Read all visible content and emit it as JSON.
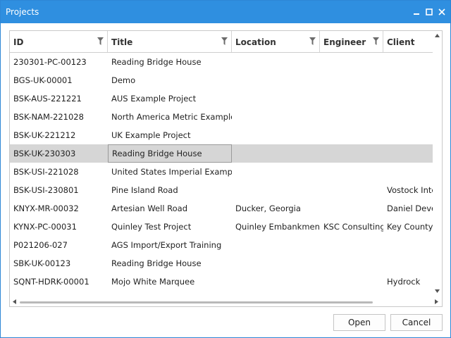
{
  "window": {
    "title": "Projects"
  },
  "columns": [
    {
      "label": "ID"
    },
    {
      "label": "Title"
    },
    {
      "label": "Location"
    },
    {
      "label": "Engineer"
    },
    {
      "label": "Client"
    }
  ],
  "rows": [
    {
      "id": "230301-PC-00123",
      "title": "Reading Bridge House",
      "location": "",
      "engineer": "",
      "client": ""
    },
    {
      "id": "BGS-UK-00001",
      "title": "Demo",
      "location": "",
      "engineer": "",
      "client": ""
    },
    {
      "id": "BSK-AUS-221221",
      "title": "AUS Example Project",
      "location": "",
      "engineer": "",
      "client": ""
    },
    {
      "id": "BSK-NAM-221028",
      "title": "North America Metric Example P",
      "location": "",
      "engineer": "",
      "client": ""
    },
    {
      "id": "BSK-UK-221212",
      "title": "UK Example Project",
      "location": "",
      "engineer": "",
      "client": ""
    },
    {
      "id": "BSK-UK-230303",
      "title": "Reading Bridge House",
      "location": "",
      "engineer": "",
      "client": "",
      "selected": true
    },
    {
      "id": "BSK-USI-221028",
      "title": "United States Imperial Example F",
      "location": "",
      "engineer": "",
      "client": ""
    },
    {
      "id": "BSK-USI-230801",
      "title": "Pine Island Road",
      "location": "",
      "engineer": "",
      "client": "Vostock Intern"
    },
    {
      "id": "KNYX-MR-00032",
      "title": "Artesian Well Road",
      "location": "Ducker, Georgia",
      "engineer": "",
      "client": "Daniel Develo"
    },
    {
      "id": "KYNX-PC-00031",
      "title": "Quinley Test Project",
      "location": "Quinley Embankment",
      "engineer": "KSC Consulting",
      "client": "Key County U"
    },
    {
      "id": "P021206-027",
      "title": "AGS Import/Export Training",
      "location": "",
      "engineer": "",
      "client": ""
    },
    {
      "id": "SBK-UK-00123",
      "title": "Reading Bridge House",
      "location": "",
      "engineer": "",
      "client": ""
    },
    {
      "id": "SQNT-HDRK-00001",
      "title": "Mojo White Marquee",
      "location": "",
      "engineer": "",
      "client": "Hydrock"
    }
  ],
  "buttons": {
    "open": "Open",
    "cancel": "Cancel"
  },
  "icons": {
    "minimize": "minimize-icon",
    "maximize": "maximize-icon",
    "close": "close-icon",
    "filter": "filter-icon"
  },
  "colors": {
    "titlebar": "#2f8fe0",
    "selected_row": "#d6d6d6"
  }
}
